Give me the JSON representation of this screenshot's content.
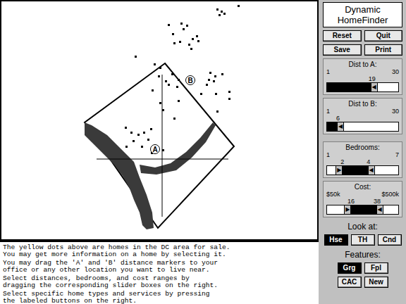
{
  "app": {
    "title_lines": [
      "Dynamic",
      "HomeFinder"
    ]
  },
  "buttons": [
    [
      "Reset",
      "Quit"
    ],
    [
      "Save",
      "Print"
    ]
  ],
  "map": {
    "markers": [
      {
        "label": "A"
      },
      {
        "label": "B"
      }
    ]
  },
  "sliders": [
    {
      "kind": "single",
      "label": "Dist to A:",
      "min": "1",
      "max": "30",
      "value": "19",
      "level": 0.63,
      "thumb": "◀"
    },
    {
      "kind": "single",
      "label": "Dist to B:",
      "min": "1",
      "max": "30",
      "value": "6",
      "level": 0.16,
      "thumb": "◀"
    },
    {
      "kind": "range",
      "label": "Bedrooms:",
      "min": "1",
      "max": "7",
      "low": "2",
      "high": "4",
      "low_level": 0.22,
      "high_level": 0.58,
      "low_thumb": "▶",
      "high_thumb": "◀"
    },
    {
      "kind": "range",
      "label": "Cost:",
      "min": "$50k",
      "max": "$500k",
      "low": "16",
      "high": "38",
      "low_level": 0.34,
      "high_level": 0.7,
      "low_thumb": "▶",
      "high_thumb": "◀"
    }
  ],
  "look_at": {
    "label": "Look at:",
    "options": [
      {
        "label": "Hse",
        "selected": true
      },
      {
        "label": "TH",
        "selected": false
      },
      {
        "label": "Cnd",
        "selected": false
      }
    ]
  },
  "features": {
    "label": "Features:",
    "options": [
      {
        "label": "Grg",
        "selected": true
      },
      {
        "label": "Fpl",
        "selected": false
      },
      {
        "label": "CAC",
        "selected": false
      },
      {
        "label": "New",
        "selected": false
      }
    ]
  },
  "instructions": [
    [
      "The yellow dots above are homes in the DC area for sale.",
      "You may get more information on a home by selecting it."
    ],
    [
      "You may drag the 'A' and 'B' distance markers to your",
      "office or any other location you want to live near."
    ],
    [
      "Select distances, bedrooms, and cost ranges by",
      "dragging the corresponding slider boxes on the right."
    ],
    [
      "Select specific home types and services by pressing",
      "the labeled buttons on the right."
    ]
  ]
}
